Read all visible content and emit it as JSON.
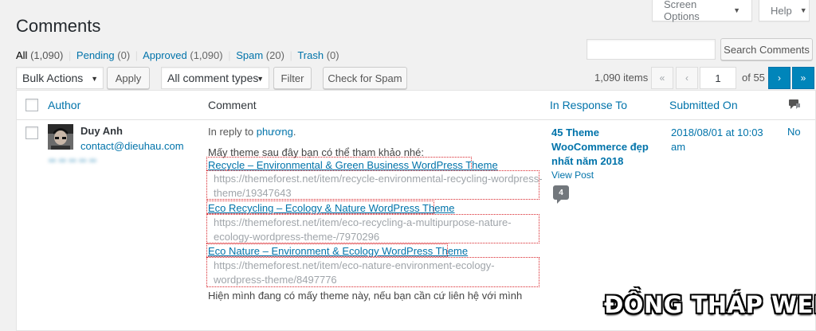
{
  "header": {
    "title": "Comments",
    "screen_options": "Screen Options",
    "help": "Help"
  },
  "filters": {
    "all": {
      "label": "All",
      "count": "(1,090)"
    },
    "pending": {
      "label": "Pending",
      "count": "(0)"
    },
    "approved": {
      "label": "Approved",
      "count": "(1,090)"
    },
    "spam": {
      "label": "Spam",
      "count": "(20)"
    },
    "trash": {
      "label": "Trash",
      "count": "(0)"
    },
    "separator": "|"
  },
  "search": {
    "placeholder": "",
    "button": "Search Comments"
  },
  "bulk": {
    "select": "Bulk Actions",
    "apply": "Apply",
    "types": "All comment types",
    "filter": "Filter",
    "check_spam": "Check for Spam"
  },
  "pagination": {
    "items": "1,090 items",
    "first": "«",
    "prev": "‹",
    "current": "1",
    "of": "of 55",
    "next": "›",
    "last": "»"
  },
  "columns": {
    "author": "Author",
    "comment": "Comment",
    "in_response": "In Response To",
    "submitted": "Submitted On"
  },
  "row": {
    "author_name": "Duy Anh",
    "author_email": "contact@dieuhau.com",
    "author_ip": "•• •• •• •• ••",
    "reply_prefix": "In reply to",
    "reply_to": "phương",
    "reply_suffix": ".",
    "intro": "Mấy theme sau đây bạn có thể tham khảo nhé:",
    "links": [
      {
        "title": "Recycle – Environmental & Green Business WordPress Theme",
        "url1": "https://themeforest.net/item/recycle-environmental-recycling-wordpress-",
        "url2": "theme/19347643"
      },
      {
        "title": "Eco Recycling – Ecology & Nature WordPress Theme",
        "url1": "https://themeforest.net/item/eco-recycling-a-multipurpose-nature-",
        "url2": "ecology-wordpress-theme-/7970296"
      },
      {
        "title": "Eco Nature – Environment & Ecology WordPress Theme",
        "url1": "https://themeforest.net/item/eco-nature-environment-ecology-",
        "url2": "wordpress-theme/8497776"
      }
    ],
    "outro": "Hiện mình đang có mấy theme này, nếu bạn cần cứ liên hệ với mình",
    "post_title_1": "45 Theme",
    "post_title_2": "WooCommerce đẹp",
    "post_title_3": "nhất năm 2018",
    "view_post": "View Post",
    "comment_count": "4",
    "date_1": "2018/08/01 at 10:03",
    "date_2": "am",
    "extra": "No"
  },
  "watermark": "ĐỒNG THÁP WEB",
  "colors": {
    "link": "#0073aa",
    "accent": "#0085ba",
    "highlight_box": "#d9262c",
    "background": "#f1f1f1"
  },
  "icons": {
    "caret": "caret-down-icon",
    "comments_column": "comment-bubble-icon"
  }
}
